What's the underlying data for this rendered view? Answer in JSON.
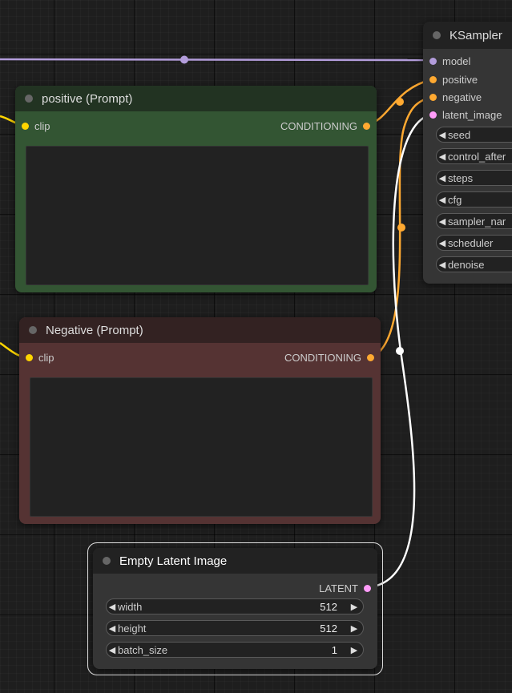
{
  "colors": {
    "model": "#b39ddb",
    "clip": "#ffd500",
    "conditioning": "#ffa931",
    "latent": "#ff9cf9",
    "positive_body": "#335533",
    "positive_title": "#223322",
    "negative_body": "#553333",
    "negative_title": "#332222",
    "node_body": "#353535",
    "node_title": "#222222"
  },
  "ksampler": {
    "title": "KSampler",
    "inputs": [
      {
        "label": "model",
        "type": "model"
      },
      {
        "label": "positive",
        "type": "conditioning"
      },
      {
        "label": "negative",
        "type": "conditioning"
      },
      {
        "label": "latent_image",
        "type": "latent"
      }
    ],
    "widgets": [
      "seed",
      "control_after",
      "steps",
      "cfg",
      "sampler_nar",
      "scheduler",
      "denoise"
    ]
  },
  "positive": {
    "title": "positive (Prompt)",
    "input_label": "clip",
    "output_label": "CONDITIONING",
    "text": ""
  },
  "negative": {
    "title": "Negative (Prompt)",
    "input_label": "clip",
    "output_label": "CONDITIONING",
    "text": ""
  },
  "latent": {
    "title": "Empty Latent Image",
    "output_label": "LATENT",
    "widgets": [
      {
        "label": "width",
        "value": "512"
      },
      {
        "label": "height",
        "value": "512"
      },
      {
        "label": "batch_size",
        "value": "1"
      }
    ]
  },
  "icons": {
    "left": "◀",
    "right": "▶"
  }
}
